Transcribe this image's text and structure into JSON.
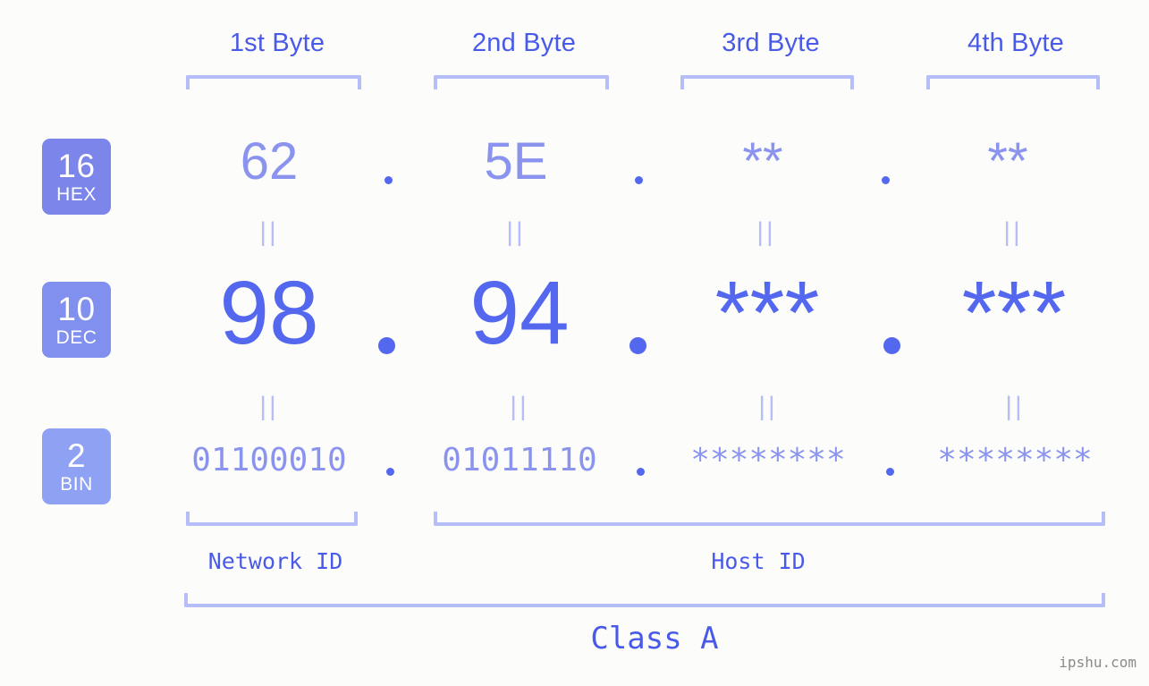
{
  "meta": {
    "background_color": "#fcfdfa",
    "accent_strong": "#4a5ae8",
    "accent_mid": "#5468ef",
    "accent_light": "#8a94ee",
    "accent_pale": "#b6befa"
  },
  "headers": {
    "bytes": [
      {
        "label": "1st Byte"
      },
      {
        "label": "2nd Byte"
      },
      {
        "label": "3rd Byte"
      },
      {
        "label": "4th Byte"
      }
    ]
  },
  "rows": [
    {
      "key": "hex",
      "badge": {
        "number": "16",
        "abbr": "HEX",
        "color": "#7b85ea"
      },
      "values": [
        "62",
        "5E",
        "**",
        "**"
      ],
      "separator": "."
    },
    {
      "key": "dec",
      "badge": {
        "number": "10",
        "abbr": "DEC",
        "color": "#8190ee"
      },
      "values": [
        "98",
        "94",
        "***",
        "***"
      ],
      "separator": "."
    },
    {
      "key": "bin",
      "badge": {
        "number": "2",
        "abbr": "BIN",
        "color": "#8fa1f2"
      },
      "values": [
        "01100010",
        "01011110",
        "********",
        "********"
      ],
      "separator": "."
    }
  ],
  "equivalence_mark": "||",
  "segments": {
    "network_id": "Network ID",
    "host_id": "Host ID"
  },
  "class": {
    "label": "Class A"
  },
  "watermark": "ipshu.com"
}
